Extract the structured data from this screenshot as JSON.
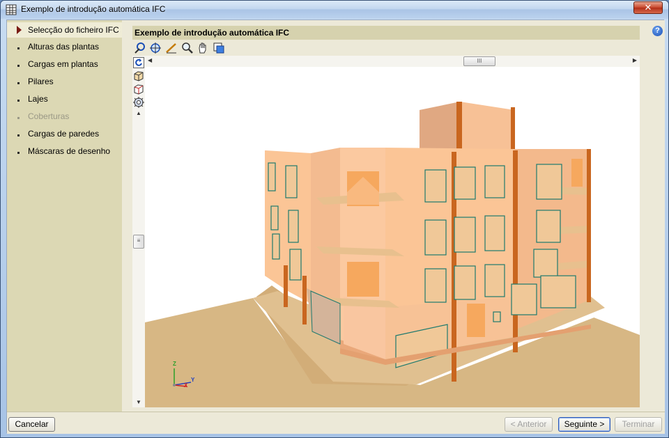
{
  "window": {
    "title": "Exemplo de introdução automática IFC",
    "close_label": "✕"
  },
  "sidebar": {
    "items": [
      {
        "label": "Selecção do ficheiro IFC",
        "state": "active"
      },
      {
        "label": "Alturas das plantas",
        "state": "normal"
      },
      {
        "label": "Cargas em plantas",
        "state": "normal"
      },
      {
        "label": "Pilares",
        "state": "normal"
      },
      {
        "label": "Lajes",
        "state": "normal"
      },
      {
        "label": "Coberturas",
        "state": "disabled"
      },
      {
        "label": "Cargas de paredes",
        "state": "normal"
      },
      {
        "label": "Máscaras de desenho",
        "state": "normal"
      }
    ]
  },
  "panel": {
    "title": "Exemplo de introdução automática IFC"
  },
  "toolbar": {
    "icons": [
      "rotate-view-icon",
      "zoom-window-icon",
      "measure-icon",
      "zoom-icon",
      "pan-hand-icon",
      "layers-icon"
    ]
  },
  "vertical_toolbar": {
    "icons": [
      "refresh-icon",
      "cube-solid-icon",
      "cube-wire-icon",
      "gear-view-icon"
    ]
  },
  "scroll": {
    "h_thumb_label": "III",
    "v_thumb_label": "≡"
  },
  "axes": {
    "z": "Z",
    "y": "Y",
    "x": "X"
  },
  "help": {
    "label": "?"
  },
  "buttons": {
    "cancel": "Cancelar",
    "previous": "< Anterior",
    "next": "Seguinte >",
    "finish": "Terminar"
  },
  "colors": {
    "facade": "#fbc596",
    "facade_shade": "#e8b088",
    "ground": "#d9b886",
    "window_frame": "#1e7a6e",
    "column": "#c9661f",
    "sidebar": "#dcd8b4"
  }
}
